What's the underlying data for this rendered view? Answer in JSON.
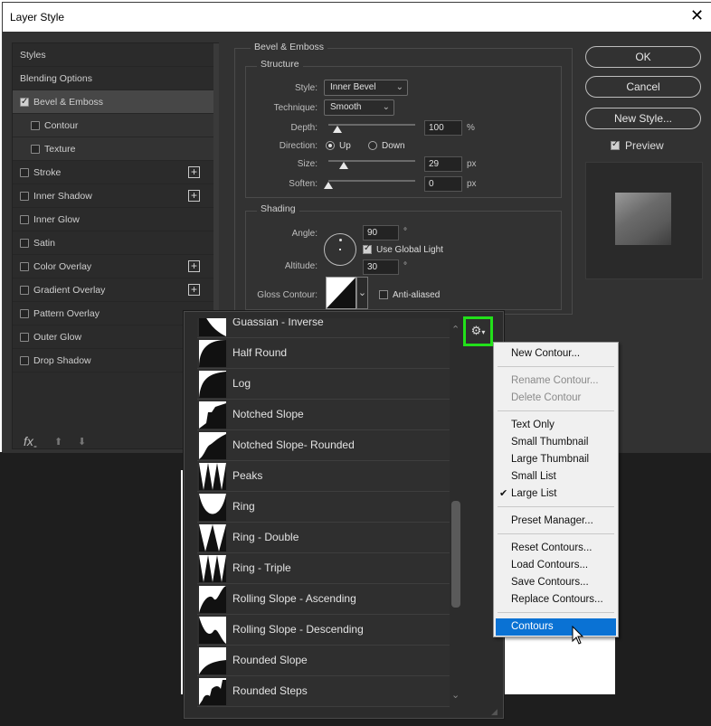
{
  "window": {
    "title": "Layer Style",
    "close_glyph": "✕"
  },
  "left_panel": {
    "items": [
      {
        "label": "Styles",
        "checkbox": false,
        "checked": false,
        "plus": false,
        "indent": 0,
        "active": false
      },
      {
        "label": "Blending Options",
        "checkbox": false,
        "checked": false,
        "plus": false,
        "indent": 0,
        "active": false
      },
      {
        "label": "Bevel & Emboss",
        "checkbox": true,
        "checked": true,
        "plus": false,
        "indent": 0,
        "active": true
      },
      {
        "label": "Contour",
        "checkbox": true,
        "checked": false,
        "plus": false,
        "indent": 1,
        "active": false
      },
      {
        "label": "Texture",
        "checkbox": true,
        "checked": false,
        "plus": false,
        "indent": 1,
        "active": false
      },
      {
        "label": "Stroke",
        "checkbox": true,
        "checked": false,
        "plus": true,
        "indent": 0,
        "active": false
      },
      {
        "label": "Inner Shadow",
        "checkbox": true,
        "checked": false,
        "plus": true,
        "indent": 0,
        "active": false
      },
      {
        "label": "Inner Glow",
        "checkbox": true,
        "checked": false,
        "plus": false,
        "indent": 0,
        "active": false
      },
      {
        "label": "Satin",
        "checkbox": true,
        "checked": false,
        "plus": false,
        "indent": 0,
        "active": false
      },
      {
        "label": "Color Overlay",
        "checkbox": true,
        "checked": false,
        "plus": true,
        "indent": 0,
        "active": false
      },
      {
        "label": "Gradient Overlay",
        "checkbox": true,
        "checked": false,
        "plus": true,
        "indent": 0,
        "active": false
      },
      {
        "label": "Pattern Overlay",
        "checkbox": true,
        "checked": false,
        "plus": false,
        "indent": 0,
        "active": false
      },
      {
        "label": "Outer Glow",
        "checkbox": true,
        "checked": false,
        "plus": false,
        "indent": 0,
        "active": false
      },
      {
        "label": "Drop Shadow",
        "checkbox": true,
        "checked": false,
        "plus": false,
        "indent": 0,
        "active": false
      }
    ],
    "fx_label": "fx",
    "fx_caret": "-",
    "up_glyph": "⬆",
    "down_glyph": "⬇"
  },
  "bevel": {
    "title": "Bevel & Emboss",
    "structure_title": "Structure",
    "style_label": "Style:",
    "style_value": "Inner Bevel",
    "technique_label": "Technique:",
    "technique_value": "Smooth",
    "depth_label": "Depth:",
    "depth_value": "100",
    "depth_unit": "%",
    "direction_label": "Direction:",
    "direction_up": "Up",
    "direction_down": "Down",
    "size_label": "Size:",
    "size_value": "29",
    "size_unit": "px",
    "soften_label": "Soften:",
    "soften_value": "0",
    "soften_unit": "px"
  },
  "shading": {
    "title": "Shading",
    "angle_label": "Angle:",
    "angle_value": "90",
    "degree": "°",
    "use_global_light": "Use Global Light",
    "altitude_label": "Altitude:",
    "altitude_value": "30",
    "gloss_label": "Gloss Contour:",
    "anti_aliased": "Anti-aliased"
  },
  "buttons": {
    "ok": "OK",
    "cancel": "Cancel",
    "new_style": "New Style...",
    "preview": "Preview"
  },
  "contour_list": [
    "Guassian - Inverse",
    "Half Round",
    "Log",
    "Notched Slope",
    "Notched Slope- Rounded",
    "Peaks",
    "Ring",
    "Ring - Double",
    "Ring - Triple",
    "Rolling Slope - Ascending",
    "Rolling Slope - Descending",
    "Rounded Slope",
    "Rounded Steps"
  ],
  "gear": {
    "glyph": "⚙",
    "caret": "▾"
  },
  "scroll_arrows": {
    "up": "⌃",
    "down": "⌄"
  },
  "menu": {
    "new_contour": "New Contour...",
    "rename_contour": "Rename Contour...",
    "delete_contour": "Delete Contour",
    "text_only": "Text Only",
    "small_thumbnail": "Small Thumbnail",
    "large_thumbnail": "Large Thumbnail",
    "small_list": "Small List",
    "large_list": "Large List",
    "check": "✔",
    "preset_manager": "Preset Manager...",
    "reset_contours": "Reset Contours...",
    "load_contours": "Load Contours...",
    "save_contours": "Save Contours...",
    "replace_contours": "Replace Contours...",
    "contours": "Contours"
  },
  "colors": {
    "highlight": "#0a72d4",
    "gear_outline": "#22e01a",
    "dialog_bg": "#323232"
  }
}
